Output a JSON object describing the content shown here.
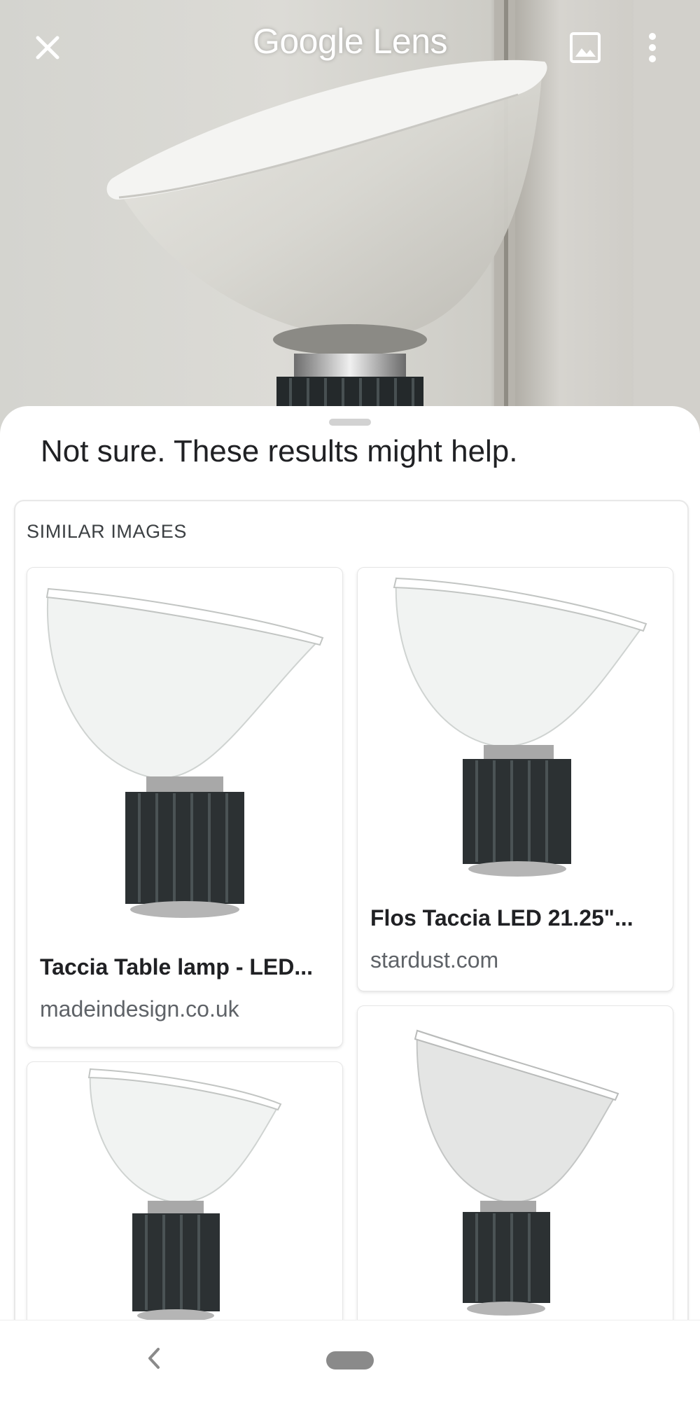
{
  "header": {
    "title_google": "Google",
    "title_lens": "Lens",
    "icons": [
      "close-icon",
      "image-gallery-icon",
      "more-vert-icon"
    ]
  },
  "sheet": {
    "headline": "Not sure. These results might help."
  },
  "similar": {
    "section_title": "SIMILAR IMAGES",
    "results": [
      {
        "title": "Taccia Table lamp - LED...",
        "source": "madeindesign.co.uk"
      },
      {
        "title": "Flos Taccia LED 21.25\"...",
        "source": "stardust.com"
      }
    ]
  },
  "nav": {
    "icons": [
      "back-icon",
      "home-pill"
    ]
  },
  "colors": {
    "text_primary": "#202124",
    "text_secondary": "#5f6368",
    "lamp_base": "#2c3133"
  }
}
